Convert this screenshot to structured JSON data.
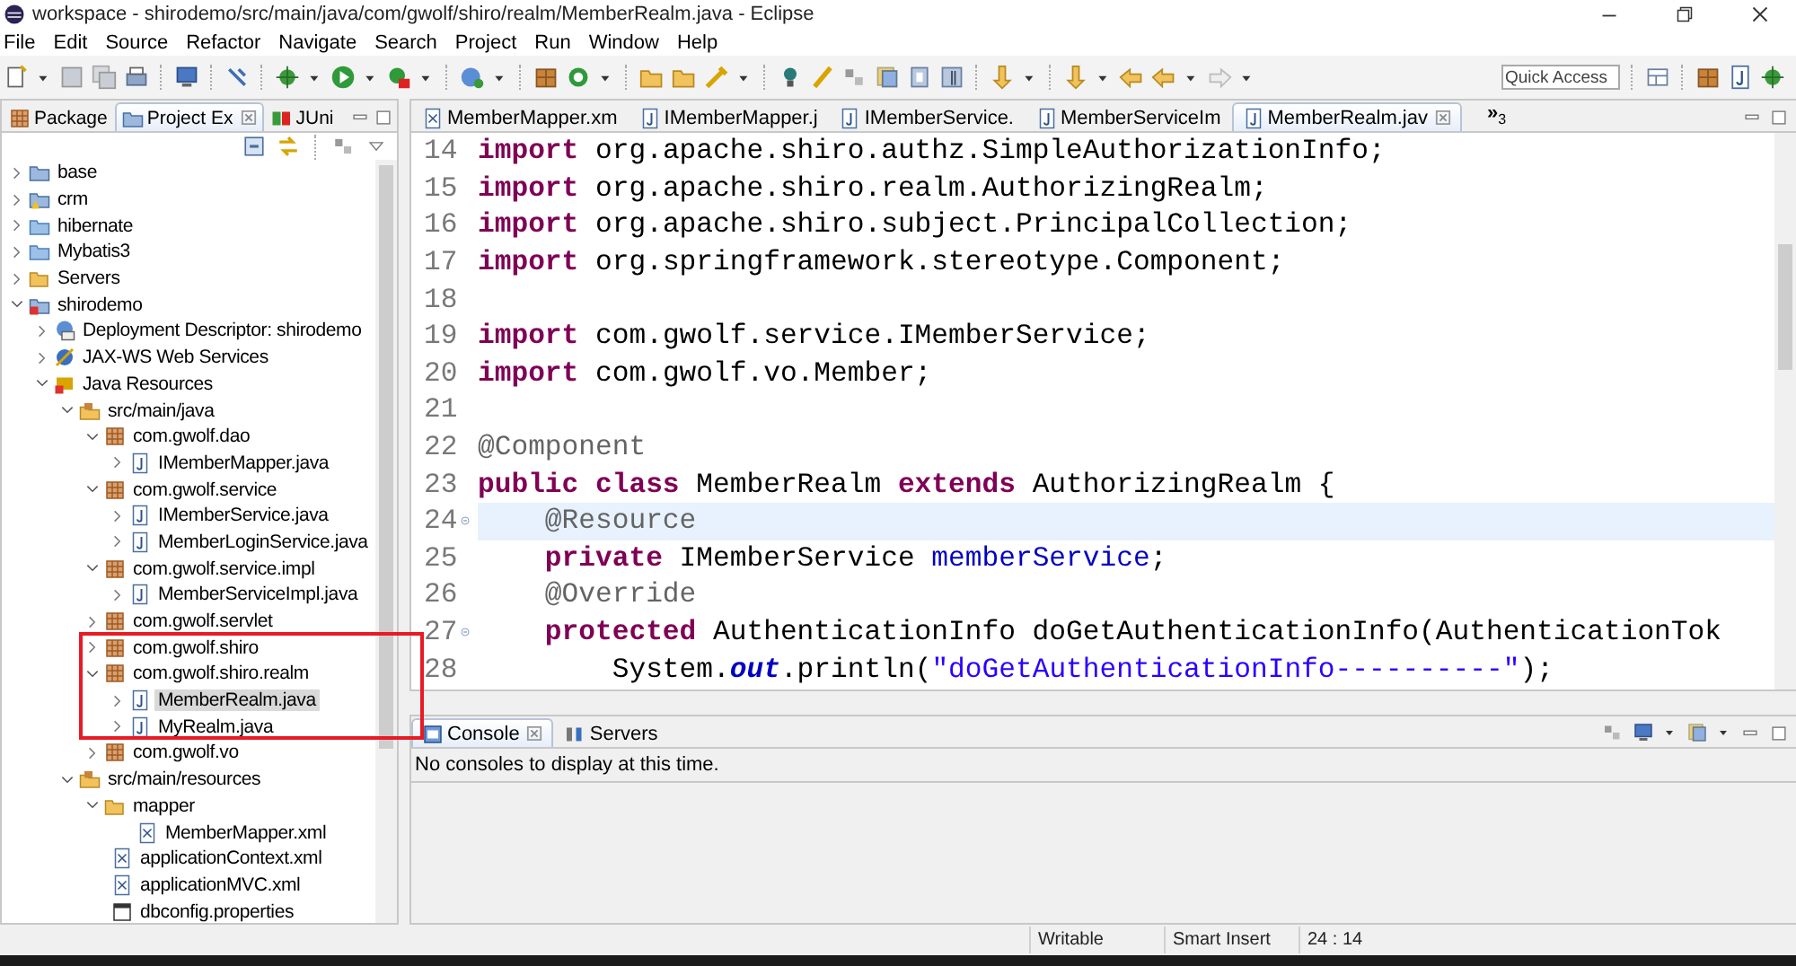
{
  "window": {
    "title": "workspace - shirodemo/src/main/java/com/gwolf/shiro/realm/MemberRealm.java - Eclipse"
  },
  "menu": [
    "File",
    "Edit",
    "Source",
    "Refactor",
    "Navigate",
    "Search",
    "Project",
    "Run",
    "Window",
    "Help"
  ],
  "toolbar": {
    "quick_access": {
      "placeholder": "Quick Access"
    }
  },
  "sidebar": {
    "tabs": [
      {
        "label": "Package",
        "selected": false,
        "kind": "package"
      },
      {
        "label": "Project Ex",
        "selected": true,
        "kind": "project"
      },
      {
        "label": "JUni",
        "selected": false,
        "kind": "junit"
      }
    ],
    "tree": [
      {
        "label": "base",
        "kind": "project",
        "expandable": true,
        "expanded": false,
        "selected": false
      },
      {
        "label": "crm",
        "kind": "project-warning",
        "expandable": true,
        "expanded": false,
        "selected": false
      },
      {
        "label": "hibernate",
        "kind": "folder",
        "expandable": true,
        "expanded": false,
        "selected": false
      },
      {
        "label": "Mybatis3",
        "kind": "folder",
        "expandable": true,
        "expanded": false,
        "selected": false
      },
      {
        "label": "Servers",
        "kind": "folder-open",
        "expandable": true,
        "expanded": false,
        "selected": false
      },
      {
        "label": "shirodemo",
        "kind": "project-error",
        "expandable": true,
        "expanded": true,
        "selected": false,
        "children": [
          {
            "label": "Deployment Descriptor: shirodemo",
            "kind": "descriptor",
            "expandable": true,
            "expanded": false,
            "selected": false
          },
          {
            "label": "JAX-WS Web Services",
            "kind": "webservice",
            "expandable": true,
            "expanded": false,
            "selected": false
          },
          {
            "label": "Java Resources",
            "kind": "java-resources",
            "expandable": true,
            "expanded": true,
            "selected": false,
            "children": [
              {
                "label": "src/main/java",
                "kind": "source-folder",
                "expandable": true,
                "expanded": true,
                "selected": false,
                "children": [
                  {
                    "label": "com.gwolf.dao",
                    "kind": "package",
                    "expandable": true,
                    "expanded": true,
                    "selected": false,
                    "children": [
                      {
                        "label": "IMemberMapper.java",
                        "kind": "java-file",
                        "expandable": true,
                        "expanded": false,
                        "selected": false
                      }
                    ]
                  },
                  {
                    "label": "com.gwolf.service",
                    "kind": "package",
                    "expandable": true,
                    "expanded": true,
                    "selected": false,
                    "children": [
                      {
                        "label": "IMemberService.java",
                        "kind": "java-file",
                        "expandable": true,
                        "expanded": false,
                        "selected": false
                      },
                      {
                        "label": "MemberLoginService.java",
                        "kind": "java-file",
                        "expandable": true,
                        "expanded": false,
                        "selected": false
                      }
                    ]
                  },
                  {
                    "label": "com.gwolf.service.impl",
                    "kind": "package",
                    "expandable": true,
                    "expanded": true,
                    "selected": false,
                    "children": [
                      {
                        "label": "MemberServiceImpl.java",
                        "kind": "java-file",
                        "expandable": true,
                        "expanded": false,
                        "selected": false
                      }
                    ]
                  },
                  {
                    "label": "com.gwolf.servlet",
                    "kind": "package",
                    "expandable": true,
                    "expanded": false,
                    "selected": false
                  },
                  {
                    "label": "com.gwolf.shiro",
                    "kind": "package",
                    "expandable": true,
                    "expanded": false,
                    "selected": false
                  },
                  {
                    "label": "com.gwolf.shiro.realm",
                    "kind": "package",
                    "expandable": true,
                    "expanded": true,
                    "selected": false,
                    "children": [
                      {
                        "label": "MemberRealm.java",
                        "kind": "java-file",
                        "expandable": true,
                        "expanded": false,
                        "selected": true
                      },
                      {
                        "label": "MyRealm.java",
                        "kind": "java-file",
                        "expandable": true,
                        "expanded": false,
                        "selected": false
                      }
                    ]
                  },
                  {
                    "label": "com.gwolf.vo",
                    "kind": "package",
                    "expandable": true,
                    "expanded": false,
                    "selected": false
                  }
                ]
              },
              {
                "label": "src/main/resources",
                "kind": "source-folder",
                "expandable": true,
                "expanded": true,
                "selected": false,
                "children": [
                  {
                    "label": "mapper",
                    "kind": "folder-open",
                    "expandable": true,
                    "expanded": true,
                    "selected": false,
                    "children": [
                      {
                        "label": "MemberMapper.xml",
                        "kind": "xml-file",
                        "expandable": false,
                        "selected": false
                      }
                    ]
                  },
                  {
                    "label": "applicationContext.xml",
                    "kind": "xml-file",
                    "expandable": false,
                    "selected": false
                  },
                  {
                    "label": "applicationMVC.xml",
                    "kind": "xml-file",
                    "expandable": false,
                    "selected": false
                  },
                  {
                    "label": "dbconfig.properties",
                    "kind": "properties-file",
                    "expandable": false,
                    "selected": false
                  }
                ]
              }
            ]
          }
        ]
      }
    ]
  },
  "editor": {
    "tabs": [
      {
        "label": "MemberMapper.xm",
        "kind": "xml-file",
        "selected": false
      },
      {
        "label": "IMemberMapper.j",
        "kind": "java-file",
        "selected": false
      },
      {
        "label": "IMemberService.",
        "kind": "java-file",
        "selected": false
      },
      {
        "label": "MemberServiceIm",
        "kind": "java-file",
        "selected": false
      },
      {
        "label": "MemberRealm.jav",
        "kind": "java-file",
        "selected": true
      }
    ],
    "overflow": {
      "glyph": "»",
      "count": "3"
    },
    "lines": [
      {
        "number": "14",
        "current": false,
        "fold": false,
        "tokens": [
          {
            "kind": "kw",
            "text": "import"
          },
          {
            "kind": "plain",
            "text": " org.apache.shiro.authz.SimpleAuthorizationInfo;"
          }
        ]
      },
      {
        "number": "15",
        "current": false,
        "fold": false,
        "tokens": [
          {
            "kind": "kw",
            "text": "import"
          },
          {
            "kind": "plain",
            "text": " org.apache.shiro.realm.AuthorizingRealm;"
          }
        ]
      },
      {
        "number": "16",
        "current": false,
        "fold": false,
        "tokens": [
          {
            "kind": "kw",
            "text": "import"
          },
          {
            "kind": "plain",
            "text": " org.apache.shiro.subject.PrincipalCollection;"
          }
        ]
      },
      {
        "number": "17",
        "current": false,
        "fold": false,
        "tokens": [
          {
            "kind": "kw",
            "text": "import"
          },
          {
            "kind": "plain",
            "text": " org.springframework.stereotype.Component;"
          }
        ]
      },
      {
        "number": "18",
        "current": false,
        "fold": false
      },
      {
        "number": "19",
        "current": false,
        "fold": false,
        "tokens": [
          {
            "kind": "kw",
            "text": "import"
          },
          {
            "kind": "plain",
            "text": " com.gwolf.service.IMemberService;"
          }
        ]
      },
      {
        "number": "20",
        "current": false,
        "fold": false,
        "tokens": [
          {
            "kind": "kw",
            "text": "import"
          },
          {
            "kind": "plain",
            "text": " com.gwolf.vo.Member;"
          }
        ]
      },
      {
        "number": "21",
        "current": false,
        "fold": false
      },
      {
        "number": "22",
        "current": false,
        "fold": false,
        "tokens": [
          {
            "kind": "ann",
            "text": "@Component"
          }
        ]
      },
      {
        "number": "23",
        "current": false,
        "fold": false,
        "tokens": [
          {
            "kind": "kw",
            "text": "public class"
          },
          {
            "kind": "plain",
            "text": " MemberRealm "
          },
          {
            "kind": "kw",
            "text": "extends"
          },
          {
            "kind": "plain",
            "text": " AuthorizingRealm {"
          }
        ],
        "children": [
          {
            "number": "24",
            "current": true,
            "fold": true,
            "tokens": [
              {
                "kind": "ann",
                "text": "@Resource"
              }
            ]
          },
          {
            "number": "25",
            "current": false,
            "fold": false,
            "tokens": [
              {
                "kind": "kw",
                "text": "private"
              },
              {
                "kind": "plain",
                "text": " IMemberService "
              },
              {
                "kind": "field",
                "text": "memberService"
              },
              {
                "kind": "plain",
                "text": ";"
              }
            ]
          },
          {
            "number": "26",
            "current": false,
            "fold": false,
            "tokens": [
              {
                "kind": "ann",
                "text": "@Override"
              }
            ]
          },
          {
            "number": "27",
            "current": false,
            "fold": true,
            "tokens": [
              {
                "kind": "kw",
                "text": "protected"
              },
              {
                "kind": "plain",
                "text": " AuthenticationInfo doGetAuthenticationInfo(AuthenticationTok"
              }
            ],
            "children": [
              {
                "number": "28",
                "current": false,
                "fold": false,
                "tokens": [
                  {
                    "kind": "plain",
                    "text": "System."
                  },
                  {
                    "kind": "static",
                    "text": "out"
                  },
                  {
                    "kind": "plain",
                    "text": ".println("
                  },
                  {
                    "kind": "string",
                    "text": "\"doGetAuthenticationInfo----------\""
                  },
                  {
                    "kind": "plain",
                    "text": ");"
                  }
                ]
              }
            ]
          }
        ]
      }
    ]
  },
  "console": {
    "tabs": [
      {
        "label": "Console",
        "kind": "console",
        "selected": true
      },
      {
        "label": "Servers",
        "kind": "servers",
        "selected": false
      }
    ],
    "message": "No consoles to display at this time."
  },
  "status_bar": [
    "Writable",
    "Smart Insert",
    "24 : 14"
  ]
}
